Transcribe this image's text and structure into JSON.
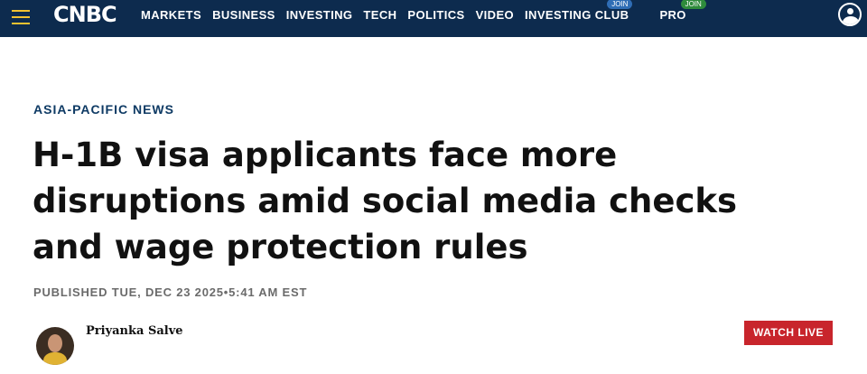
{
  "header": {
    "logo": "CNBC",
    "nav": [
      {
        "label": "MARKETS"
      },
      {
        "label": "BUSINESS"
      },
      {
        "label": "INVESTING"
      },
      {
        "label": "TECH"
      },
      {
        "label": "POLITICS"
      },
      {
        "label": "VIDEO"
      },
      {
        "label": "INVESTING CLUB",
        "badge": "JOIN"
      },
      {
        "label": "PRO",
        "badge": "JOIN"
      }
    ],
    "icons": [
      "hamburger-menu-icon",
      "user-profile-icon"
    ],
    "colors": {
      "bar": "#0d2b4e",
      "menu_icon": "#f2c230",
      "club_badge": "#2f6db5",
      "pro_badge": "#2e8b3c"
    }
  },
  "article": {
    "section": "ASIA-PACIFIC NEWS",
    "headline_lines": [
      "H-1B visa applicants face more",
      "disruptions amid social media checks",
      "and wage protection rules"
    ],
    "published": "PUBLISHED TUE, DEC 23 2025•5:41 AM EST",
    "author": "Priyanka Salve"
  },
  "actions": {
    "watch_live": "WATCH LIVE",
    "watch_live_color": "#c8252c"
  }
}
